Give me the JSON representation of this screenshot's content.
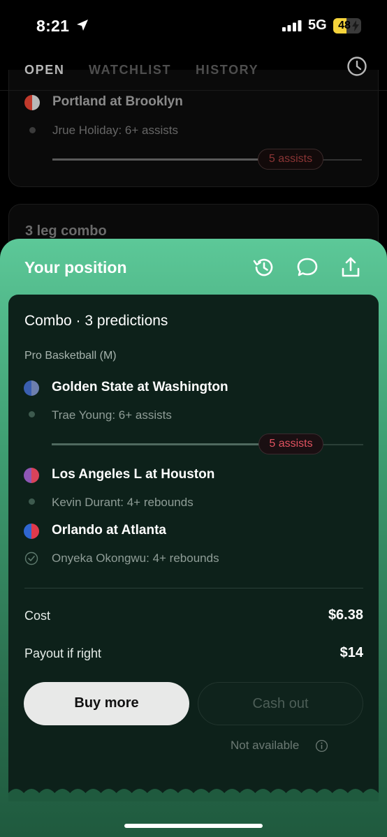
{
  "status_bar": {
    "time": "8:21",
    "network": "5G",
    "battery": "48",
    "battery_level": 0.48,
    "icons": [
      "location-arrow-icon",
      "signal-bars-icon",
      "battery-charging-icon"
    ]
  },
  "tabs": [
    {
      "label": "OPEN",
      "active": true
    },
    {
      "label": "WATCHLIST",
      "active": false
    },
    {
      "label": "HISTORY",
      "active": false
    }
  ],
  "background": {
    "card1": {
      "game": "Portland at Brooklyn",
      "leg": "Jrue Holiday: 6+ assists",
      "progress_label": "5 assists",
      "progress_level": 0.78
    },
    "card2": {
      "title": "3 leg combo"
    }
  },
  "sheet": {
    "title": "Your position",
    "icons": [
      "history-icon",
      "chat-icon",
      "share-icon"
    ],
    "combo_title": "Combo · 3 predictions",
    "league": "Pro Basketball (M)",
    "legs": [
      {
        "game": "Golden State at Washington",
        "colors": [
          "#3a5fb0",
          "#6d7fae"
        ],
        "leg": "Trae Young: 6+ assists",
        "status": "open",
        "progress_label": "5 assists",
        "progress_level": 0.83
      },
      {
        "game": "Los Angeles L at Houston",
        "colors": [
          "#8e57b5",
          "#d8435a"
        ],
        "leg": "Kevin Durant: 4+ rebounds",
        "status": "open"
      },
      {
        "game": "Orlando at Atlanta",
        "colors": [
          "#2f66d0",
          "#e0394b"
        ],
        "leg": "Onyeka Okongwu: 4+ rebounds",
        "status": "completed"
      }
    ],
    "cost_label": "Cost",
    "cost_value": "$6.38",
    "payout_label": "Payout if right",
    "payout_value": "$14",
    "buy_label": "Buy more",
    "cash_label": "Cash out",
    "not_available": "Not available"
  },
  "colors": {
    "accent_green": "#5cc898",
    "panel": "#0d211a",
    "red_pill_text": "#e0525f"
  }
}
